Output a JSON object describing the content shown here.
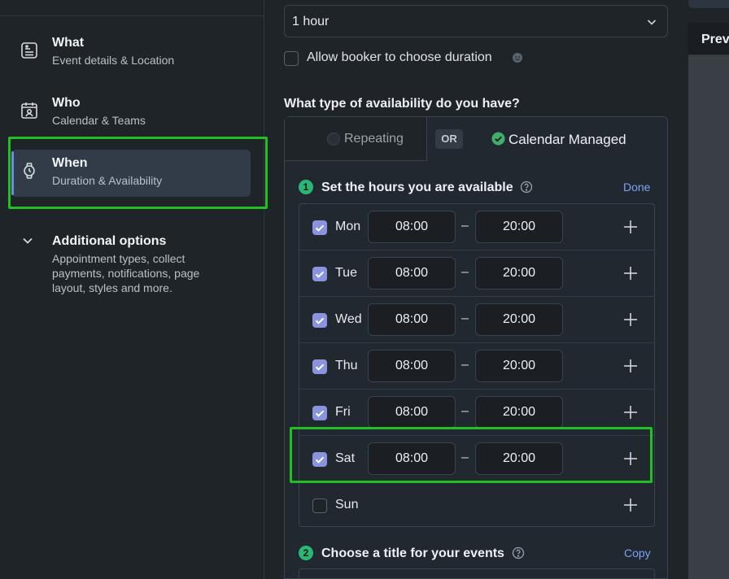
{
  "sidebar": {
    "items": [
      {
        "title": "What",
        "subtitle": "Event details & Location",
        "icon": "document-icon"
      },
      {
        "title": "Who",
        "subtitle": "Calendar & Teams",
        "icon": "calendar-user-icon"
      },
      {
        "title": "When",
        "subtitle": "Duration & Availability",
        "icon": "watch-icon",
        "active": true
      }
    ],
    "additional": {
      "title": "Additional options",
      "description": "Appointment types, collect payments, notifications, page layout, styles and more.",
      "icon": "chevron-down-icon"
    }
  },
  "duration": {
    "selected": "1 hour",
    "allow_label": "Allow booker to choose duration",
    "allow_checked": false
  },
  "availability": {
    "question": "What type of availability do you have?",
    "tab_repeating": "Repeating",
    "or_label": "OR",
    "tab_calendar": "Calendar Managed",
    "selected_tab": "Calendar Managed"
  },
  "step1": {
    "number": "1",
    "title": "Set the hours you are available",
    "action": "Done"
  },
  "days": [
    {
      "day": "Mon",
      "checked": true,
      "start": "08:00",
      "end": "20:00"
    },
    {
      "day": "Tue",
      "checked": true,
      "start": "08:00",
      "end": "20:00"
    },
    {
      "day": "Wed",
      "checked": true,
      "start": "08:00",
      "end": "20:00"
    },
    {
      "day": "Thu",
      "checked": true,
      "start": "08:00",
      "end": "20:00"
    },
    {
      "day": "Fri",
      "checked": true,
      "start": "08:00",
      "end": "20:00"
    },
    {
      "day": "Sat",
      "checked": true,
      "start": "08:00",
      "end": "20:00"
    },
    {
      "day": "Sun",
      "checked": false
    }
  ],
  "range_separator": "–",
  "step2": {
    "number": "2",
    "title": "Choose a title for your events",
    "action": "Copy"
  },
  "preview": {
    "title": "Prev"
  },
  "colors": {
    "accent_checkbox": "#8a93dd",
    "step_badge": "#2bb673",
    "link": "#7aa2f7",
    "highlight": "#22c022"
  }
}
